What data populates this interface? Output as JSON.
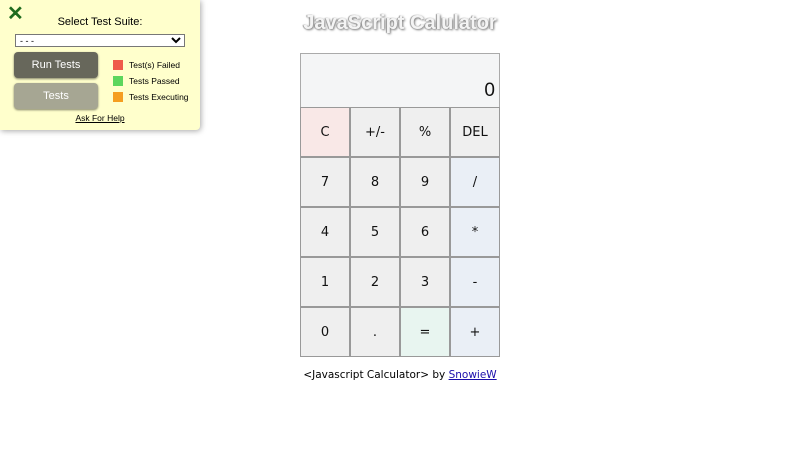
{
  "test_panel": {
    "close_glyph": "✕",
    "suite_label": "Select Test Suite:",
    "suite_selected": "- - -",
    "run_button": "Run Tests",
    "tests_button": "Tests",
    "legend": [
      {
        "label": "Test(s) Failed",
        "color": "#ef5a4a"
      },
      {
        "label": "Tests Passed",
        "color": "#5cd65c"
      },
      {
        "label": "Tests Executing",
        "color": "#f59e20"
      }
    ],
    "help_link": "Ask For Help"
  },
  "calculator": {
    "title": "JavaScript Calulator",
    "display": "0",
    "keys": [
      {
        "label": "C",
        "kind": "clear",
        "name": "clear-button"
      },
      {
        "label": "+/-",
        "kind": "num",
        "name": "sign-toggle-button"
      },
      {
        "label": "%",
        "kind": "num",
        "name": "percent-button"
      },
      {
        "label": "DEL",
        "kind": "num",
        "name": "delete-button"
      },
      {
        "label": "7",
        "kind": "num",
        "name": "digit-7-button"
      },
      {
        "label": "8",
        "kind": "num",
        "name": "digit-8-button"
      },
      {
        "label": "9",
        "kind": "num",
        "name": "digit-9-button"
      },
      {
        "label": "/",
        "kind": "op",
        "name": "divide-button"
      },
      {
        "label": "4",
        "kind": "num",
        "name": "digit-4-button"
      },
      {
        "label": "5",
        "kind": "num",
        "name": "digit-5-button"
      },
      {
        "label": "6",
        "kind": "num",
        "name": "digit-6-button"
      },
      {
        "label": "*",
        "kind": "op",
        "name": "multiply-button"
      },
      {
        "label": "1",
        "kind": "num",
        "name": "digit-1-button"
      },
      {
        "label": "2",
        "kind": "num",
        "name": "digit-2-button"
      },
      {
        "label": "3",
        "kind": "num",
        "name": "digit-3-button"
      },
      {
        "label": "-",
        "kind": "op",
        "name": "subtract-button"
      },
      {
        "label": "0",
        "kind": "num",
        "name": "digit-0-button"
      },
      {
        "label": ".",
        "kind": "num",
        "name": "decimal-button"
      },
      {
        "label": "=",
        "kind": "equals",
        "name": "equals-button"
      },
      {
        "label": "+",
        "kind": "op",
        "name": "add-button"
      }
    ]
  },
  "footer": {
    "text": "<Javascript Calculator> by ",
    "author_link": "SnowieW"
  }
}
